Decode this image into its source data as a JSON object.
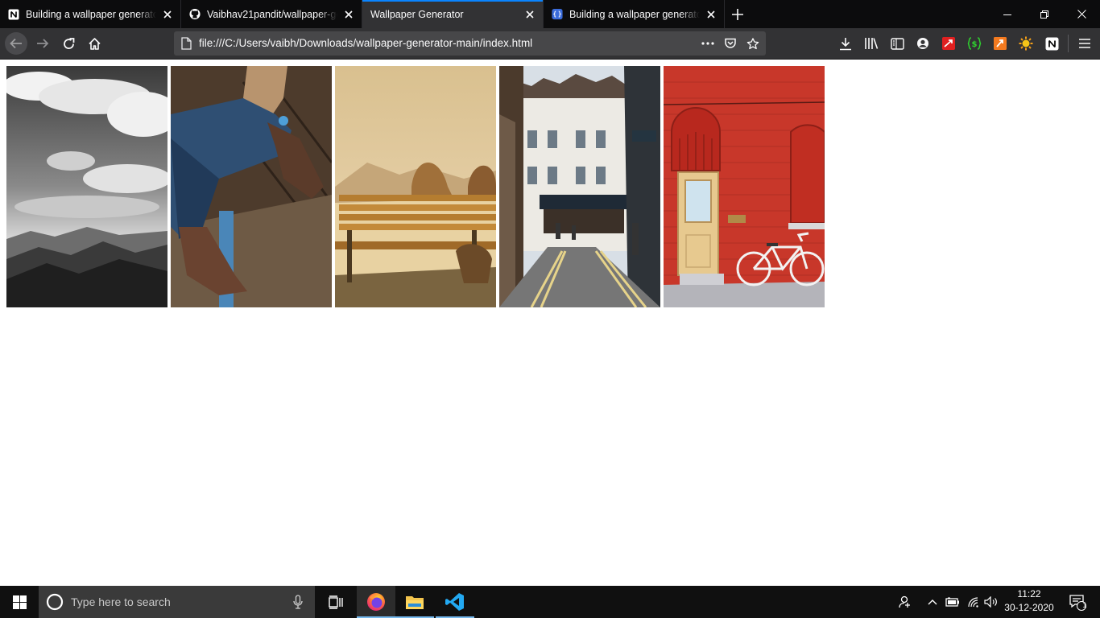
{
  "browser": {
    "tabs": [
      {
        "title": "Building a wallpaper generator",
        "favicon": "notion-icon",
        "active": false
      },
      {
        "title": "Vaibhav21pandit/wallpaper-generator",
        "favicon": "github-icon",
        "active": false
      },
      {
        "title": "Wallpaper Generator",
        "favicon": "none",
        "active": true
      },
      {
        "title": "Building a wallpaper generator",
        "favicon": "code-icon",
        "active": false
      }
    ],
    "url": "file:///C:/Users/vaibh/Downloads/wallpaper-generator-main/index.html",
    "accent_color": "#0a84ff"
  },
  "page": {
    "images": [
      {
        "subject": "black-and-white-clouds-over-mountains"
      },
      {
        "subject": "person-in-jeans-pulling-on-boots"
      },
      {
        "subject": "two-people-on-park-bench-at-sunset"
      },
      {
        "subject": "city-street-with-white-buildings"
      },
      {
        "subject": "red-brick-wall-with-door-and-bicycle"
      }
    ]
  },
  "taskbar": {
    "search_placeholder": "Type here to search",
    "time": "11:22",
    "date": "30-12-2020",
    "notification_count": "1"
  }
}
